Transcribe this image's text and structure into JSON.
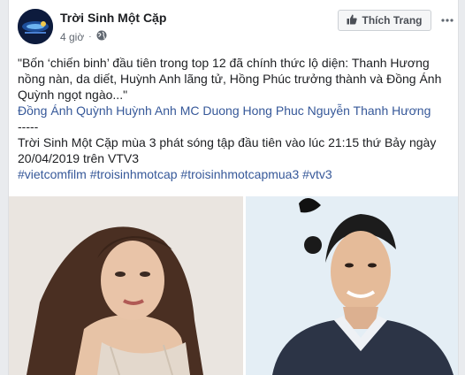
{
  "page": {
    "name": "Trời Sinh Một Cặp",
    "time": "4 giờ",
    "like_button_label": "Thích Trang"
  },
  "post": {
    "quote": "\"Bốn ‘chiến binh’ đầu tiên trong top 12 đã chính thức lộ diện: Thanh Hương nồng nàn, da diết, Huỳnh Anh lãng tử, Hồng Phúc trưởng thành và Đồng Ánh Quỳnh ngọt ngào...\"",
    "tagged_people": [
      "Đồng Ánh Quỳnh",
      "Huỳnh Anh",
      "MC Duong Hong Phuc",
      "Nguyễn Thanh Hương"
    ],
    "separator": "-----",
    "announcement": "Trời Sinh Một Cặp mùa 3 phát sóng tập đầu tiên vào lúc 21:15 thứ Bảy ngày 20/04/2019 trên VTV3",
    "hashtags": [
      "#vietcomfilm",
      "#troisinhmotcap",
      "#troisinhmotcapmua3",
      "#vtv3"
    ]
  },
  "colors": {
    "link": "#365899",
    "text": "#1c1e21",
    "meta": "#606770",
    "background": "#e9ebee"
  },
  "icons": {
    "globe": "globe-icon",
    "thumbs_up": "thumbs-up-icon",
    "more": "more-options-icon"
  }
}
